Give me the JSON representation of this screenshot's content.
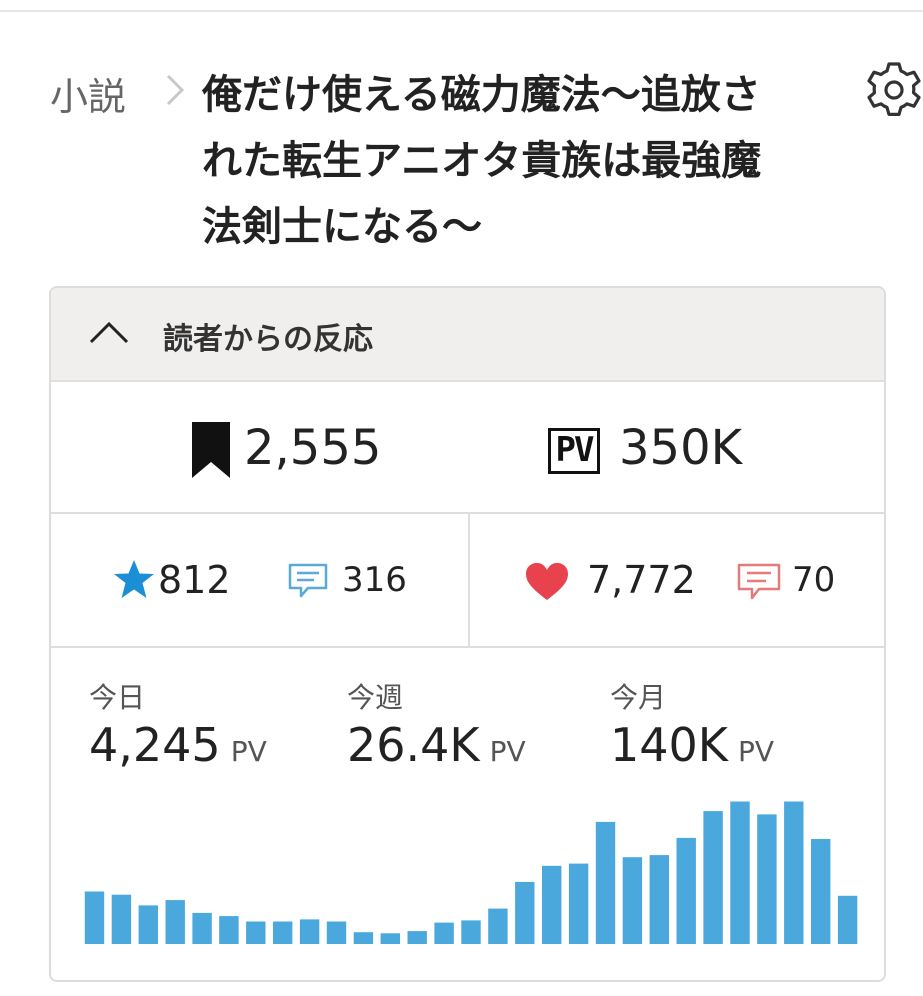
{
  "breadcrumb": {
    "root": "小説",
    "title": "俺だけ使える磁力魔法〜追放された転生アニオタ貴族は最強魔法剣士になる〜"
  },
  "reactions": {
    "header_title": "読者からの反応",
    "bookmarks": "2,555",
    "pv_badge": "PV",
    "pv_total": "350K",
    "stars": "812",
    "reviews": "316",
    "hearts": "7,772",
    "comments": "70"
  },
  "pv_stats": [
    {
      "label": "今日",
      "value": "4,245",
      "unit": "PV"
    },
    {
      "label": "今週",
      "value": "26.4K",
      "unit": "PV"
    },
    {
      "label": "今月",
      "value": "140K",
      "unit": "PV"
    }
  ],
  "colors": {
    "star": "#1a8fd6",
    "review_icon": "#5aaad8",
    "heart": "#e8424e",
    "comment_icon": "#e67a7a",
    "bar": "#4aa8dc"
  },
  "icons": {
    "settings": "gear-icon",
    "collapse": "chevron-up-icon",
    "bookmark": "bookmark-icon",
    "star": "star-icon",
    "review": "speech-bubble-icon",
    "heart": "heart-icon",
    "comment": "speech-bubble-icon"
  },
  "chart_data": {
    "type": "bar",
    "title": "",
    "xlabel": "",
    "ylabel": "",
    "values": [
      49,
      46,
      36,
      41,
      29,
      26,
      21,
      21,
      23,
      21,
      11,
      10,
      12,
      20,
      22,
      33,
      58,
      73,
      75,
      114,
      81,
      83,
      99,
      124,
      133,
      121,
      133,
      98,
      45
    ],
    "ylim": [
      0,
      140
    ],
    "grid": false
  }
}
